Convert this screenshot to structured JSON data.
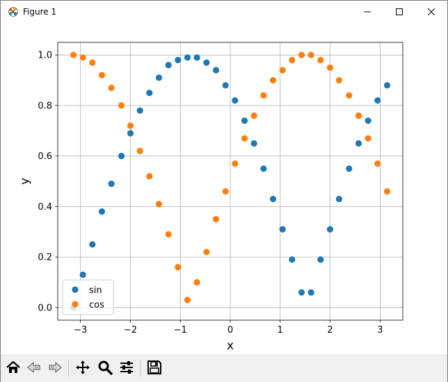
{
  "window": {
    "title": "Figure 1",
    "icons": {
      "app": "matplotlib-figure-icon",
      "minimize": "minimize-icon",
      "maximize": "maximize-icon",
      "close": "close-icon"
    }
  },
  "toolbar": {
    "buttons": [
      {
        "name": "home",
        "icon": "home-icon",
        "label": "Home"
      },
      {
        "name": "back",
        "icon": "arrow-left-icon",
        "label": "Back"
      },
      {
        "name": "forward",
        "icon": "arrow-right-icon",
        "label": "Forward"
      },
      {
        "name": "pan",
        "icon": "move-icon",
        "label": "Pan"
      },
      {
        "name": "zoom",
        "icon": "magnifier-icon",
        "label": "Zoom"
      },
      {
        "name": "configure",
        "icon": "sliders-icon",
        "label": "Configure subplots"
      },
      {
        "name": "save",
        "icon": "floppy-disk-icon",
        "label": "Save"
      }
    ]
  },
  "chart_data": {
    "type": "scatter",
    "xlabel": "x",
    "ylabel": "y",
    "xlim": [
      -3.455,
      3.455
    ],
    "ylim": [
      -0.05,
      1.05
    ],
    "xticks": [
      -3,
      -2,
      -1,
      0,
      1,
      2,
      3
    ],
    "xtick_labels": [
      "−3",
      "−2",
      "−1",
      "0",
      "1",
      "2",
      "3"
    ],
    "yticks": [
      0.0,
      0.2,
      0.4,
      0.6,
      0.8,
      1.0
    ],
    "ytick_labels": [
      "0.0",
      "0.2",
      "0.4",
      "0.6",
      "0.8",
      "1.0"
    ],
    "grid": true,
    "legend_position": "lower-left",
    "x": [
      -3.1416,
      -2.9513,
      -2.7609,
      -2.5705,
      -2.3801,
      -2.1797,
      -1.9993,
      -1.8089,
      -1.6185,
      -1.4281,
      -1.2377,
      -1.0473,
      -0.8569,
      -0.6665,
      -0.4761,
      -0.2856,
      -0.0952,
      0.0952,
      0.2856,
      0.4761,
      0.6665,
      0.8569,
      1.0473,
      1.2377,
      1.4281,
      1.6185,
      1.8089,
      1.9993,
      2.1797,
      2.3801,
      2.5705,
      2.7609,
      2.9513,
      3.1416
    ],
    "series": [
      {
        "name": "sin",
        "color": "#1f77b4",
        "values": [
          0.0,
          0.13,
          0.25,
          0.38,
          0.49,
          0.6,
          0.69,
          0.78,
          0.85,
          0.91,
          0.96,
          0.98,
          0.99,
          0.99,
          0.97,
          0.94,
          0.88,
          0.82,
          0.74,
          0.65,
          0.55,
          0.43,
          0.31,
          0.19,
          0.06,
          0.06,
          0.19,
          0.31,
          0.43,
          0.55,
          0.65,
          0.74,
          0.82,
          0.88
        ]
      },
      {
        "name": "cos",
        "color": "#ff7f0e",
        "values": [
          1.0,
          0.99,
          0.97,
          0.92,
          0.87,
          0.8,
          0.72,
          0.62,
          0.52,
          0.41,
          0.29,
          0.16,
          0.03,
          0.1,
          0.22,
          0.35,
          0.46,
          0.57,
          0.67,
          0.76,
          0.84,
          0.9,
          0.94,
          0.98,
          1.0,
          1.0,
          0.98,
          0.95,
          0.9,
          0.84,
          0.76,
          0.67,
          0.57,
          0.46
        ]
      }
    ]
  }
}
